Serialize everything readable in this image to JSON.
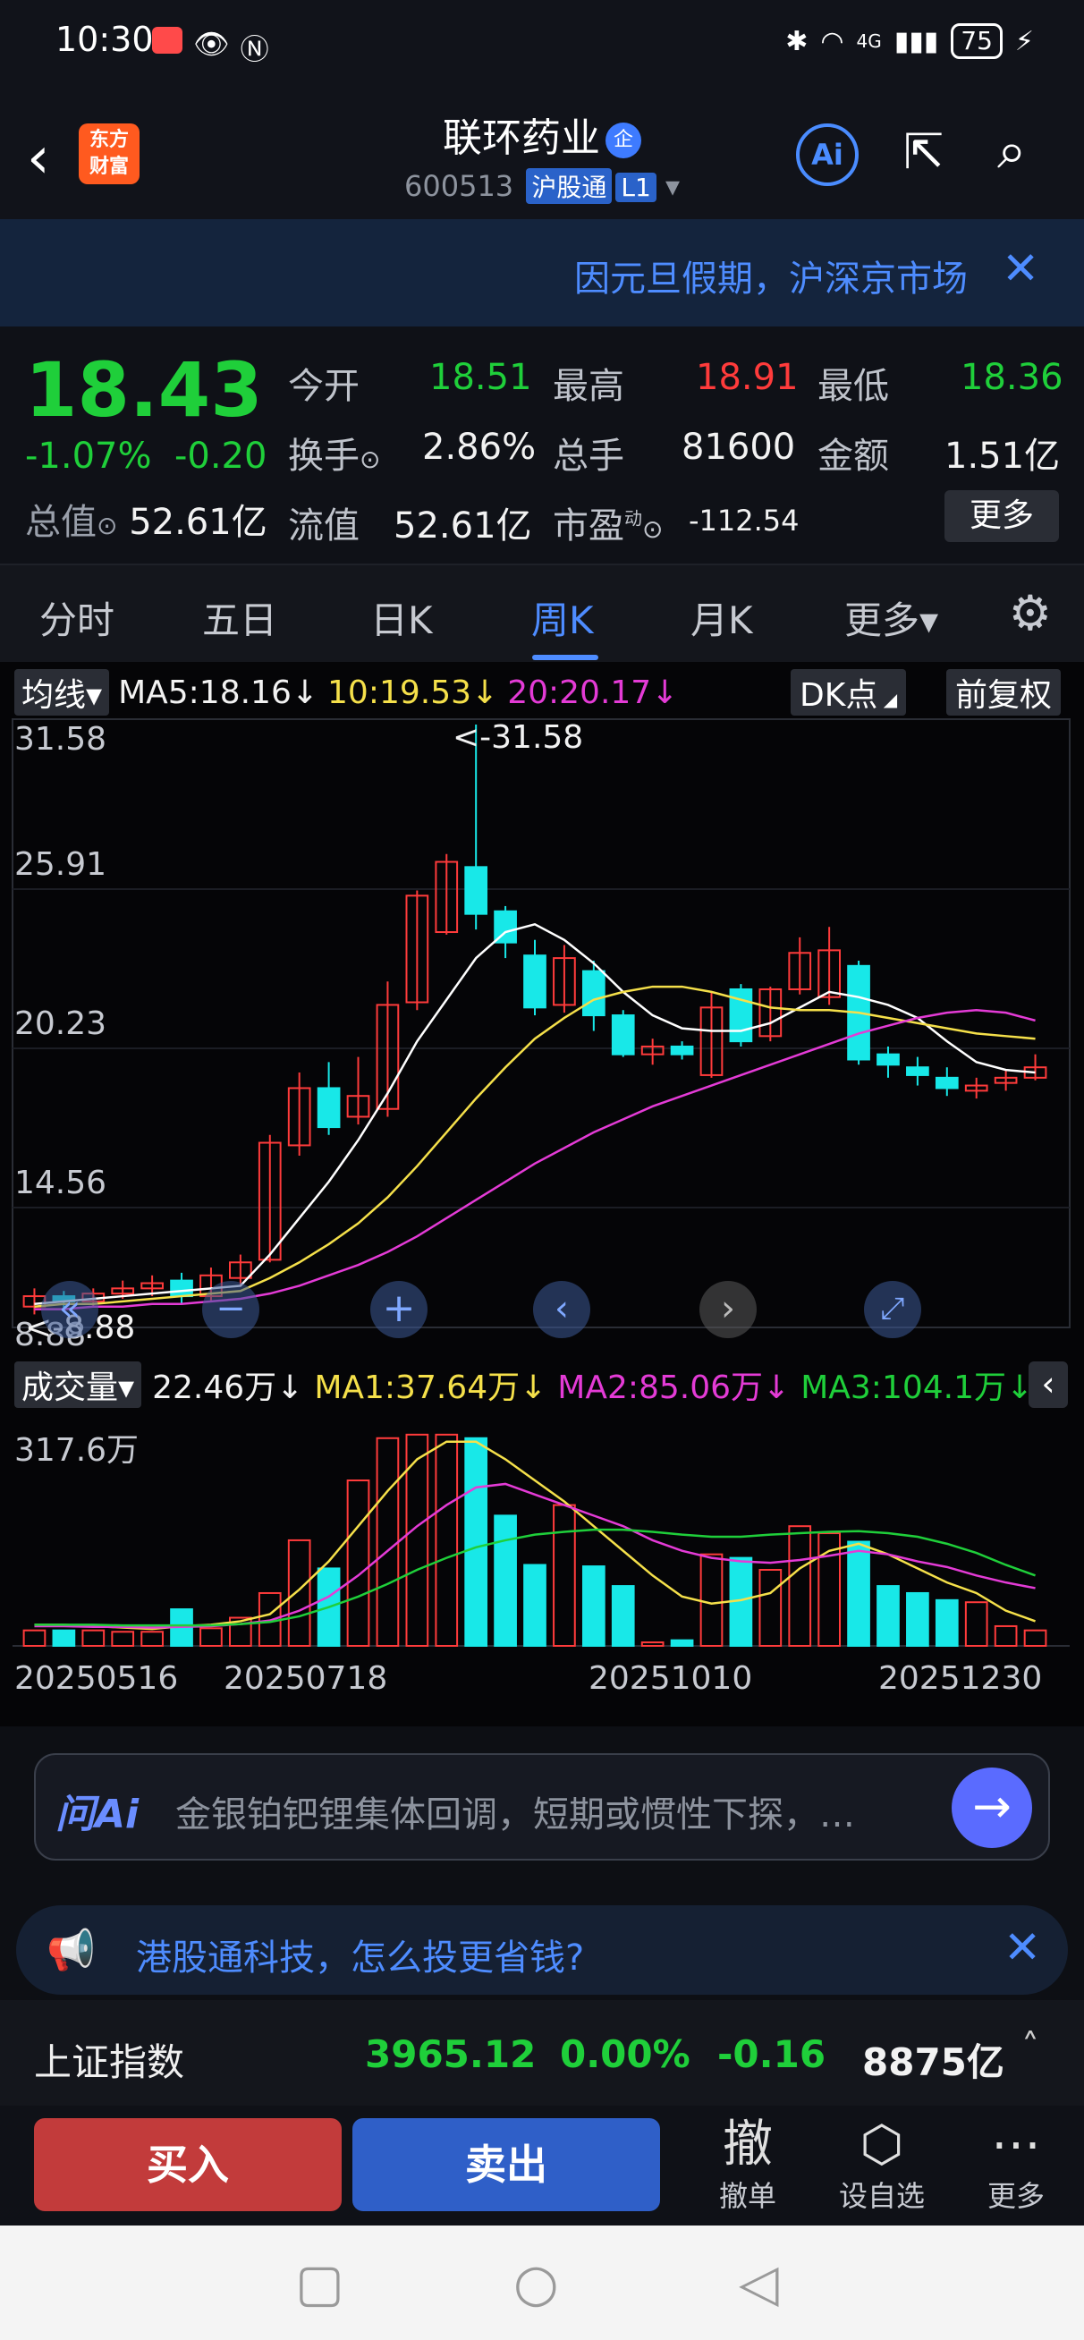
{
  "status_bar": {
    "time": "10:30",
    "network": "4G",
    "battery": "75"
  },
  "header": {
    "logo_line1": "东方",
    "logo_line2": "财富",
    "stock_name": "联环药业",
    "enterprise_badge": "企",
    "stock_code": "600513",
    "market_tag": "沪股通",
    "level_tag": "L1",
    "ai_label": "Ai"
  },
  "banner": {
    "text": "因元旦假期，沪深京市场"
  },
  "quote": {
    "price": "18.43",
    "change_pct": "-1.07%",
    "change_amt": "-0.20",
    "open_label": "今开",
    "open": "18.51",
    "high_label": "最高",
    "high": "18.91",
    "low_label": "最低",
    "low": "18.36",
    "turnover_label": "换手",
    "turnover": "2.86%",
    "volume_label": "总手",
    "volume": "81600",
    "amount_label": "金额",
    "amount": "1.51亿",
    "total_value_label": "总值",
    "total_value": "52.61亿",
    "float_value_label": "流值",
    "float_value": "52.61亿",
    "pe_label": "市盈",
    "pe_sup": "动",
    "pe": "-112.54",
    "more_label": "更多"
  },
  "tabs": [
    {
      "label": "分时"
    },
    {
      "label": "五日"
    },
    {
      "label": "日K"
    },
    {
      "label": "周K"
    },
    {
      "label": "月K"
    },
    {
      "label": "更多▾"
    }
  ],
  "kline": {
    "selector": "均线▾",
    "ma5": "MA5:18.16↓",
    "ma10": "10:19.53↓",
    "ma20": "20:20.17↓",
    "dk_label": "DK点",
    "adjust_label": "前复权",
    "y_ticks": [
      "31.58",
      "25.91",
      "20.23",
      "14.56",
      "8.88"
    ],
    "max_marker": "<-31.58",
    "min_marker": "<-8.88"
  },
  "volume_panel": {
    "selector": "成交量▾",
    "current": "22.46万↓",
    "ma1": "MA1:37.64万↓",
    "ma2": "MA2:85.06万↓",
    "ma3": "MA3:104.1万↓",
    "y_tick": "317.6万",
    "dates": [
      "20250516",
      "20250718",
      "20251010",
      "20251230"
    ]
  },
  "chart_data": {
    "type": "candlestick",
    "ylim": [
      8.88,
      31.58
    ],
    "candles": [
      {
        "o": 9.2,
        "c": 9.6,
        "h": 9.9,
        "l": 8.9
      },
      {
        "o": 9.6,
        "c": 9.4,
        "h": 9.8,
        "l": 9.1
      },
      {
        "o": 9.4,
        "c": 9.7,
        "h": 9.9,
        "l": 9.2
      },
      {
        "o": 9.7,
        "c": 9.9,
        "h": 10.2,
        "l": 9.5
      },
      {
        "o": 9.9,
        "c": 10.1,
        "h": 10.4,
        "l": 9.6
      },
      {
        "o": 10.2,
        "c": 9.6,
        "h": 10.5,
        "l": 9.3
      },
      {
        "o": 9.6,
        "c": 10.4,
        "h": 10.7,
        "l": 9.4
      },
      {
        "o": 10.3,
        "c": 10.9,
        "h": 11.2,
        "l": 10.0
      },
      {
        "o": 11.0,
        "c": 15.5,
        "h": 15.8,
        "l": 10.9
      },
      {
        "o": 15.4,
        "c": 17.6,
        "h": 18.2,
        "l": 15.0
      },
      {
        "o": 17.6,
        "c": 16.1,
        "h": 18.6,
        "l": 15.8
      },
      {
        "o": 16.5,
        "c": 17.3,
        "h": 18.8,
        "l": 16.2
      },
      {
        "o": 16.8,
        "c": 20.8,
        "h": 21.7,
        "l": 16.5
      },
      {
        "o": 20.9,
        "c": 25.0,
        "h": 25.2,
        "l": 20.6
      },
      {
        "o": 23.6,
        "c": 26.3,
        "h": 26.6,
        "l": 23.5
      },
      {
        "o": 26.1,
        "c": 24.3,
        "h": 31.58,
        "l": 23.7
      },
      {
        "o": 24.4,
        "c": 23.2,
        "h": 24.6,
        "l": 22.6
      },
      {
        "o": 22.7,
        "c": 20.7,
        "h": 23.3,
        "l": 20.4
      },
      {
        "o": 20.8,
        "c": 22.6,
        "h": 23.1,
        "l": 20.5
      },
      {
        "o": 22.1,
        "c": 20.4,
        "h": 22.5,
        "l": 19.8
      },
      {
        "o": 20.4,
        "c": 18.9,
        "h": 20.6,
        "l": 18.8
      },
      {
        "o": 18.9,
        "c": 19.2,
        "h": 19.5,
        "l": 18.5
      },
      {
        "o": 19.2,
        "c": 18.9,
        "h": 19.4,
        "l": 18.7
      },
      {
        "o": 18.1,
        "c": 20.7,
        "h": 21.3,
        "l": 18.0
      },
      {
        "o": 21.4,
        "c": 19.4,
        "h": 21.6,
        "l": 19.2
      },
      {
        "o": 19.6,
        "c": 21.4,
        "h": 21.5,
        "l": 19.4
      },
      {
        "o": 21.4,
        "c": 22.8,
        "h": 23.4,
        "l": 21.2
      },
      {
        "o": 21.1,
        "c": 22.9,
        "h": 23.8,
        "l": 20.8
      },
      {
        "o": 22.3,
        "c": 18.7,
        "h": 22.5,
        "l": 18.5
      },
      {
        "o": 18.9,
        "c": 18.5,
        "h": 19.2,
        "l": 18.0
      },
      {
        "o": 18.4,
        "c": 18.1,
        "h": 18.8,
        "l": 17.7
      },
      {
        "o": 18.0,
        "c": 17.6,
        "h": 18.4,
        "l": 17.3
      },
      {
        "o": 17.5,
        "c": 17.7,
        "h": 18.0,
        "l": 17.2
      },
      {
        "o": 17.8,
        "c": 18.0,
        "h": 18.3,
        "l": 17.5
      },
      {
        "o": 18.0,
        "c": 18.4,
        "h": 18.9,
        "l": 17.9
      }
    ],
    "ma_series": [
      {
        "name": "MA5",
        "color": "#ffffff",
        "values": [
          9.3,
          9.4,
          9.5,
          9.6,
          9.7,
          9.8,
          9.9,
          10.0,
          11.2,
          12.6,
          14.0,
          15.6,
          17.4,
          19.4,
          21.0,
          22.6,
          23.6,
          23.9,
          23.3,
          22.4,
          21.3,
          20.4,
          19.9,
          19.8,
          19.8,
          20.1,
          20.7,
          21.3,
          21.1,
          20.8,
          20.3,
          19.4,
          18.6,
          18.3,
          18.2
        ]
      },
      {
        "name": "MA10",
        "color": "#f5e04a",
        "values": [
          9.2,
          9.3,
          9.3,
          9.4,
          9.5,
          9.6,
          9.7,
          9.8,
          10.3,
          10.9,
          11.6,
          12.4,
          13.4,
          14.6,
          15.9,
          17.2,
          18.4,
          19.5,
          20.3,
          21.0,
          21.3,
          21.5,
          21.5,
          21.3,
          21.0,
          20.7,
          20.6,
          20.6,
          20.5,
          20.3,
          20.1,
          19.9,
          19.7,
          19.6,
          19.5
        ]
      },
      {
        "name": "MA20",
        "color": "#e43bd6",
        "values": [
          9.1,
          9.1,
          9.2,
          9.2,
          9.3,
          9.3,
          9.4,
          9.5,
          9.7,
          10.0,
          10.4,
          10.8,
          11.3,
          11.9,
          12.6,
          13.3,
          14.0,
          14.7,
          15.3,
          15.9,
          16.4,
          16.9,
          17.3,
          17.7,
          18.1,
          18.5,
          18.9,
          19.3,
          19.7,
          20.0,
          20.3,
          20.5,
          20.6,
          20.5,
          20.2
        ]
      }
    ],
    "volume": {
      "ymax": 317.6,
      "unit": "万",
      "bars": [
        22,
        22,
        22,
        20,
        20,
        52,
        25,
        40,
        75,
        150,
        110,
        235,
        295,
        300,
        300,
        295,
        185,
        115,
        200,
        113,
        85,
        5,
        8,
        130,
        125,
        108,
        170,
        160,
        148,
        85,
        75,
        65,
        62,
        28,
        22
      ],
      "ma_series": [
        {
          "name": "MA1",
          "color": "#f5e04a",
          "values": [
            30,
            30,
            28,
            26,
            24,
            28,
            30,
            35,
            45,
            80,
            120,
            170,
            220,
            265,
            290,
            290,
            265,
            235,
            205,
            170,
            135,
            100,
            70,
            60,
            65,
            75,
            110,
            135,
            145,
            130,
            110,
            90,
            75,
            50,
            35
          ]
        },
        {
          "name": "MA2",
          "color": "#e43bd6",
          "values": [
            28,
            28,
            27,
            27,
            26,
            27,
            28,
            31,
            36,
            50,
            70,
            100,
            135,
            170,
            200,
            225,
            230,
            215,
            200,
            185,
            170,
            150,
            135,
            125,
            120,
            118,
            122,
            128,
            135,
            130,
            120,
            112,
            100,
            90,
            82
          ]
        },
        {
          "name": "MA3",
          "color": "#1fcf3a",
          "values": [
            30,
            30,
            30,
            29,
            29,
            29,
            29,
            31,
            34,
            42,
            55,
            70,
            88,
            108,
            125,
            140,
            150,
            158,
            162,
            165,
            165,
            162,
            158,
            155,
            155,
            158,
            160,
            162,
            163,
            160,
            155,
            145,
            132,
            115,
            100
          ]
        }
      ]
    }
  },
  "ask_ai": {
    "logo": "问Ai",
    "text": "金银铂钯锂集体回调，短期或惯性下探，…"
  },
  "notice": {
    "text": "港股通科技，怎么投更省钱?"
  },
  "index_bar": {
    "name": "上证指数",
    "value": "3965.12",
    "pct": "0.00%",
    "chg": "-0.16",
    "amount": "8875亿"
  },
  "trade": {
    "buy": "买入",
    "sell": "卖出",
    "cancel_icon": "撤",
    "cancel": "撤单",
    "watch": "设自选",
    "more": "更多"
  },
  "colors": {
    "up": "#ff3b3b",
    "down": "#1fcf3a",
    "down_candle": "#18e8e8",
    "accent": "#4e8cff"
  }
}
